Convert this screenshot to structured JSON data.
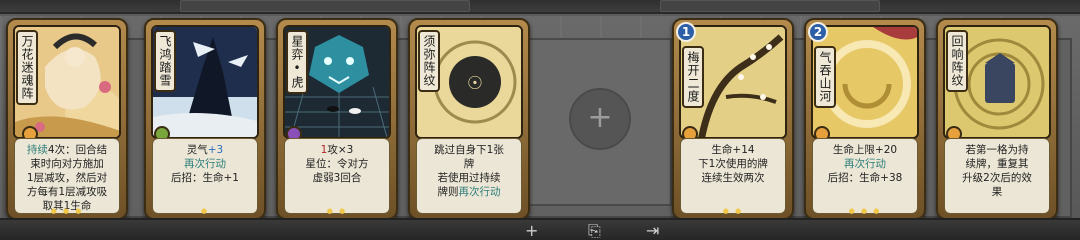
{
  "cards": [
    {
      "name": "万花迷魂阵",
      "lines": [
        [
          {
            "t": "持续",
            "c": "teal"
          },
          {
            "t": "4次：回合结"
          }
        ],
        [
          {
            "t": "束时向对方施加"
          }
        ],
        [
          {
            "t": "1层减攻，然后对"
          }
        ],
        [
          {
            "t": "方每有1层减攻吸"
          }
        ],
        [
          {
            "t": "取其1生命"
          }
        ]
      ],
      "gem_color": "#e6a03c",
      "badge": ""
    },
    {
      "name": "飞鸿踏雪",
      "lines": [
        [
          {
            "t": "灵气"
          },
          {
            "t": "+3",
            "c": "blue"
          }
        ],
        [
          {
            "t": "再次行动",
            "c": "teal"
          }
        ],
        [
          {
            "t": "后招：生命+1"
          }
        ]
      ],
      "gem_color": "#78a53c",
      "badge": ""
    },
    {
      "name": "星弈•虎",
      "lines": [
        [
          {
            "t": "1",
            "c": "red"
          },
          {
            "t": "攻×3"
          }
        ],
        [
          {
            "t": "星位：令对方"
          }
        ],
        [
          {
            "t": "虚弱3回合"
          }
        ]
      ],
      "gem_color": "#8a4fb8",
      "badge": ""
    },
    {
      "name": "须弥阵纹",
      "lines": [
        [
          {
            "t": "跳过自身下1张"
          }
        ],
        [
          {
            "t": "牌"
          }
        ],
        [
          {
            "t": "若使用过持续"
          }
        ],
        [
          {
            "t": "牌则"
          },
          {
            "t": "再次行动",
            "c": "teal"
          }
        ]
      ],
      "gem_color": "",
      "badge": ""
    },
    {
      "name": "梅开二度",
      "lines": [
        [
          {
            "t": "生命+14"
          }
        ],
        [
          {
            "t": "下1次使用的牌"
          }
        ],
        [
          {
            "t": "连续生效两次"
          }
        ]
      ],
      "gem_color": "#e6a03c",
      "badge": "1"
    },
    {
      "name": "气吞山河",
      "lines": [
        [
          {
            "t": "生命上限+20"
          }
        ],
        [
          {
            "t": "再次行动",
            "c": "teal"
          }
        ],
        [
          {
            "t": "后招：生命+38"
          }
        ]
      ],
      "gem_color": "#e6a03c",
      "badge": "2"
    },
    {
      "name": "回响阵纹",
      "lines": [
        [
          {
            "t": "若第一格为持"
          }
        ],
        [
          {
            "t": "续牌，重复其"
          }
        ],
        [
          {
            "t": "升级2次后的效"
          }
        ],
        [
          {
            "t": "果"
          }
        ]
      ],
      "gem_color": "#e6a03c",
      "badge": ""
    }
  ],
  "empty_slot": {
    "plus": "+"
  },
  "bottom_icons": {
    "add": "+",
    "deck": "⎘",
    "exit": "⇥"
  },
  "colors": {
    "teal": "#2b7e7a",
    "red": "#b3262b",
    "blue": "#2d6dc0"
  }
}
